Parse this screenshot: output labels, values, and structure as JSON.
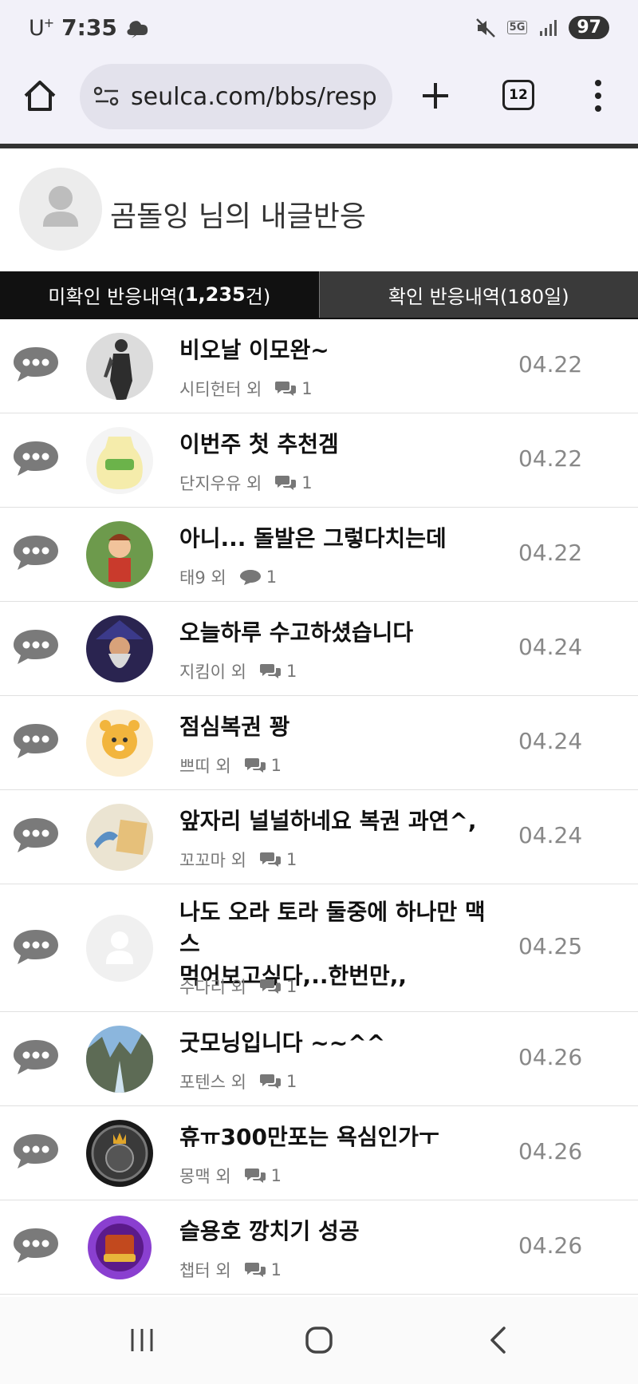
{
  "status_bar": {
    "carrier": "U",
    "carrier_sup": "+",
    "time": "7:35",
    "network": "5G",
    "battery": "97"
  },
  "browser": {
    "url": "seulca.com/bbs/resp",
    "tab_count": "12"
  },
  "profile": {
    "title": "곰돌잉 님의 내글반응"
  },
  "tabs": {
    "unread_prefix": "미확인 반응내역(",
    "unread_count": "1,235",
    "unread_suffix": "건)",
    "read_label": "확인 반응내역(180일)"
  },
  "rows": [
    {
      "title": "비오날 이모완~",
      "user": "시티헌터 외",
      "count": "1",
      "date": "04.22",
      "avatar": "man-in-coat"
    },
    {
      "title": "이번주 첫 추천겜",
      "user": "단지우유 외",
      "count": "1",
      "date": "04.22",
      "avatar": "banana-milk"
    },
    {
      "title": "아니... 돌발은 그렇다치는데",
      "user": "태9 외",
      "count": "1",
      "date": "04.22",
      "avatar": "cartoon-boy"
    },
    {
      "title": "오늘하루 수고하셨습니다",
      "user": "지킴이 외",
      "count": "1",
      "date": "04.24",
      "avatar": "wizard"
    },
    {
      "title": "점심복권 꽝",
      "user": "쁘띠 외",
      "count": "1",
      "date": "04.24",
      "avatar": "tiger-cub"
    },
    {
      "title": "앞자리 널널하네요 복권 과연^,",
      "user": "꼬꼬마 외",
      "count": "1",
      "date": "04.24",
      "avatar": "shark-doodle"
    },
    {
      "title_line1": "나도 오라 토라 둘중에 하나만 맥스",
      "title_line2": "먹어보고싶다,..한번만,,",
      "user": "수다리 외",
      "count": "1",
      "date": "04.25",
      "avatar": "default-person"
    },
    {
      "title": "굿모닝입니다 ~~^^",
      "user": "포텐스 외",
      "count": "1",
      "date": "04.26",
      "avatar": "canyon"
    },
    {
      "title": "휴ㅠ300만포는 욕심인가ㅜ",
      "user": "몽맥 외",
      "count": "1",
      "date": "04.26",
      "avatar": "play-coin"
    },
    {
      "title": "슬용호 깡치기 성공",
      "user": "챕터 외",
      "count": "1",
      "date": "04.26",
      "avatar": "slot-badge"
    }
  ],
  "colors": {
    "chrome_bg": "#f2f1f9",
    "tab_active": "#111111",
    "tab_inactive": "#3a3a3a",
    "icon_gray": "#7a7a7a"
  }
}
